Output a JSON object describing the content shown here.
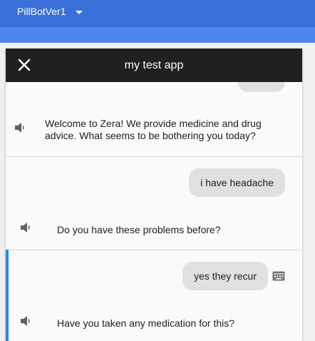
{
  "agent": {
    "name": "PillBotVer1"
  },
  "dialog": {
    "title": "my test app"
  },
  "conversation": {
    "messages": [
      {
        "role": "bot",
        "text": "Welcome to Zera! We provide medicine and drug advice. What seems to be bothering you today?"
      },
      {
        "role": "user",
        "text": "i have headache"
      },
      {
        "role": "bot",
        "text": "Do you have these problems before?"
      },
      {
        "role": "user",
        "text": "yes they recur"
      },
      {
        "role": "bot",
        "text": "Have you taken any medication for this?"
      }
    ]
  },
  "icons": {
    "close": "close-icon",
    "speaker": "speaker-icon",
    "keyboard": "keyboard-icon",
    "agent_dropdown": "chevron-down-icon"
  },
  "colors": {
    "topbar": "#3a6fd8",
    "subbar": "#4d86ee",
    "dialog_header": "#202020",
    "user_bubble": "#e0e0e0",
    "active_turn_bar": "#2a86e4"
  }
}
